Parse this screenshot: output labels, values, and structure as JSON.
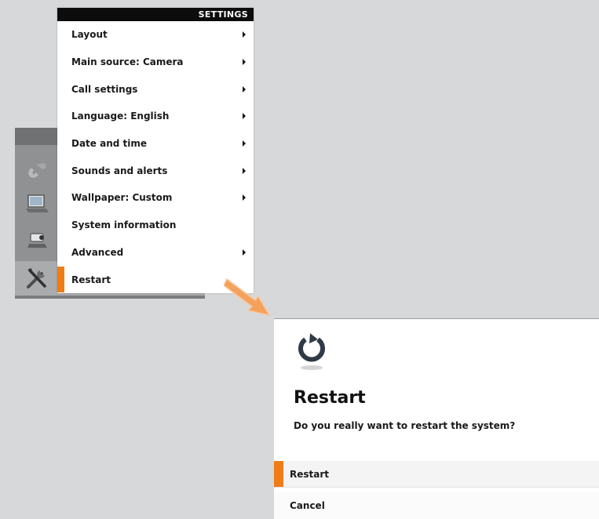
{
  "settings_menu": {
    "header": "SETTINGS",
    "items": [
      {
        "label": "Layout",
        "has_submenu": true
      },
      {
        "label": "Main source: Camera",
        "has_submenu": true
      },
      {
        "label": "Call settings",
        "has_submenu": true
      },
      {
        "label": "Language: English",
        "has_submenu": true
      },
      {
        "label": "Date and time",
        "has_submenu": true
      },
      {
        "label": "Sounds and alerts",
        "has_submenu": true
      },
      {
        "label": "Wallpaper: Custom",
        "has_submenu": true
      },
      {
        "label": "System information",
        "has_submenu": false
      },
      {
        "label": "Advanced",
        "has_submenu": true
      },
      {
        "label": "Restart",
        "has_submenu": false,
        "selected": true
      }
    ]
  },
  "dock": {
    "icons": [
      "phone-icon",
      "laptop-icon",
      "camera-icon",
      "tools-icon"
    ],
    "selected": "tools-icon"
  },
  "dialog": {
    "icon": "restart-icon",
    "title": "Restart",
    "message": "Do you really want to restart the system?",
    "buttons": {
      "restart": "Restart",
      "cancel": "Cancel"
    }
  },
  "colors": {
    "accent": "#f07c17",
    "arrow": "#f4a15d",
    "background": "#d7d8da"
  }
}
